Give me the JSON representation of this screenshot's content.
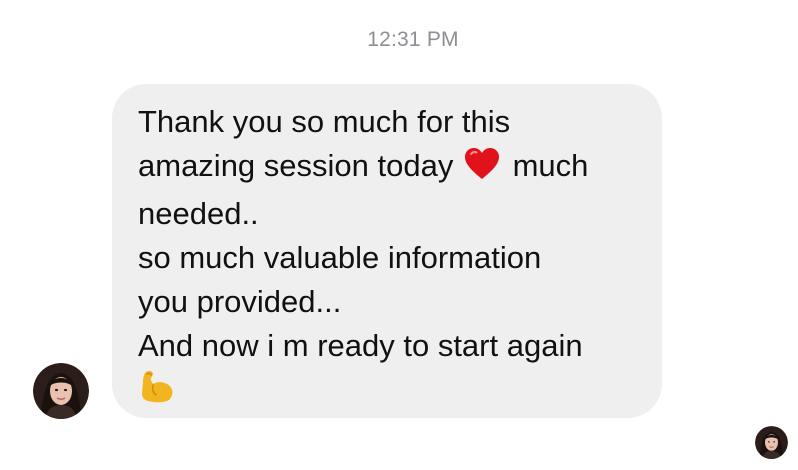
{
  "thread": {
    "timestamp": "12:31 PM"
  },
  "message": {
    "lines": [
      {
        "text": "Thank you so much for this"
      },
      {
        "before": "amazing session today",
        "emoji": "red-heart-icon",
        "after": "much"
      },
      {
        "text": "needed.."
      },
      {
        "text": "so much valuable information"
      },
      {
        "text": "you provided..."
      },
      {
        "text": "And now i m ready to start again"
      },
      {
        "emoji": "flexed-biceps-icon"
      }
    ],
    "bubble_color": "#efefef",
    "text_color": "#111111"
  },
  "sender": {
    "avatar_icon": "profile-photo",
    "seen_indicator_icon": "profile-photo"
  },
  "colors": {
    "timestamp": "#8e8e93",
    "heart": "#e1121c",
    "biceps": "#f2b41f"
  }
}
